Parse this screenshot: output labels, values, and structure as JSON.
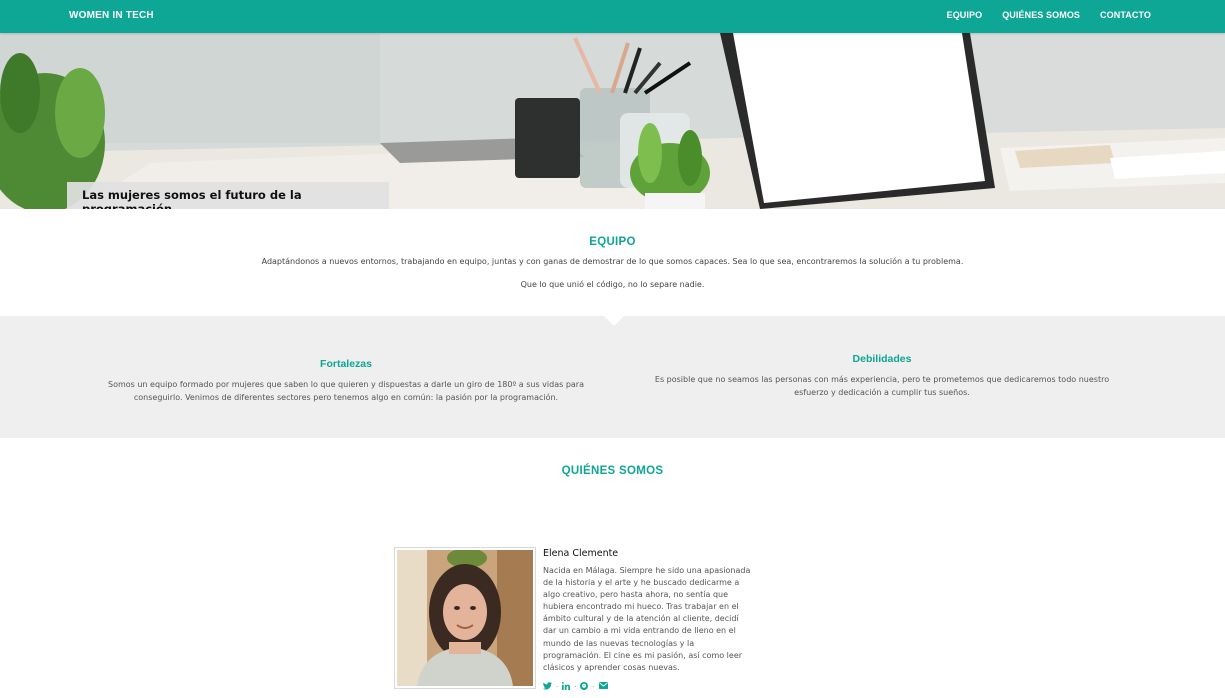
{
  "navbar": {
    "brand": "WOMEN IN TECH",
    "links": [
      "EQUIPO",
      "QUIÉNES SOMOS",
      "CONTACTO"
    ]
  },
  "hero": {
    "caption": "Las mujeres somos el futuro de la programación."
  },
  "equipo": {
    "title": "EQUIPO",
    "paragraph1": "Adaptándonos a nuevos entornos, trabajando en equipo, juntas y con ganas de demostrar de lo que somos capaces. Sea lo que sea, encontraremos la solución a tu problema.",
    "paragraph2": "Que lo que unió el código, no lo separe nadie."
  },
  "fortalezas": {
    "title": "Fortalezas",
    "text": "Somos un equipo formado por mujeres que saben lo que quieren y dispuestas a darle un giro de 180º a sus vidas para conseguirlo. Venimos de diferentes sectores pero tenemos algo en común: la pasión por la programación."
  },
  "debilidades": {
    "title": "Debilidades",
    "text": "Es posible que no seamos las personas con más experiencia, pero te prometemos que dedicaremos todo nuestro esfuerzo y dedicación a cumplir tus sueños."
  },
  "quienes": {
    "title": "QUIÉNES SOMOS",
    "member": {
      "name": "Elena Clemente",
      "bio": "Nacida en Málaga. Siempre he sido una apasionada de la historia y el arte y he buscado dedicarme a algo creativo, pero hasta ahora, no sentía que hubiera encontrado mi hueco. Tras trabajar en el ámbito cultural y de la atención al cliente, decidí dar un cambio a mi vida entrando de lleno en el mundo de las nuevas tecnologías y la programación. El cine es mi pasión, así como leer clásicos y aprender cosas nuevas.",
      "socials": [
        "twitter-icon",
        "linkedin-icon",
        "github-icon",
        "envelope-icon"
      ],
      "separator": "·"
    }
  },
  "colors": {
    "accent": "#0ea694",
    "grey_band": "#efefef"
  }
}
